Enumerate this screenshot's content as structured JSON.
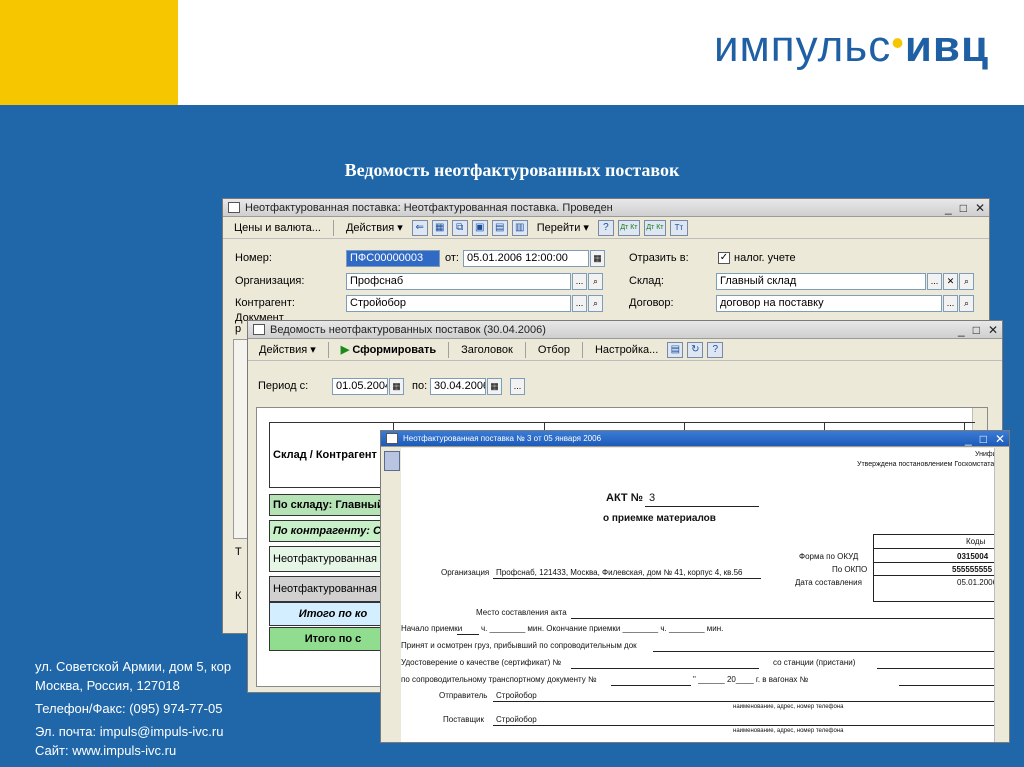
{
  "logo": {
    "left": "импульс",
    "dot": "•",
    "right": "ивц"
  },
  "slide_title": "Ведомость неотфактурованных поставок",
  "contacts": [
    "ул. Советской Армии, дом 5, кор",
    "Москва, Россия, 127018",
    "Телефон/Факс: (095) 974-77-05",
    "Эл. почта: impuls@impuls-ivc.ru",
    "Сайт: www.impuls-ivc.ru"
  ],
  "window1": {
    "title": "Неотфактурованная поставка: Неотфактурованная поставка. Проведен",
    "toolbar": {
      "prices": "Цены и валюта...",
      "actions": "Действия",
      "goto": "Перейти"
    },
    "labels": {
      "number": "Номер:",
      "org": "Организация:",
      "contractor": "Контрагент:",
      "doc": "Документ",
      "from": "от:",
      "reflect": "Отразить в:",
      "warehouse": "Склад:",
      "contract": "Договор:",
      "t_edge": "Т",
      "k_edge": "К",
      "r_edge": "р"
    },
    "values": {
      "number": "ПФС00000003",
      "date": "05.01.2006 12:00:00",
      "tax": "налог. учете",
      "org": "Профснаб",
      "warehouse": "Главный склад",
      "contractor": "Стройобор",
      "contract": "договор на поставку"
    },
    "tt_icons": [
      "Дт Кт",
      "Дт Кт",
      "Тт"
    ]
  },
  "window2": {
    "title": "Ведомость неотфактурованных поставок (30.04.2006)",
    "toolbar": {
      "actions": "Действия",
      "generate": "Сформировать",
      "header": "Заголовок",
      "filter": "Отбор",
      "settings": "Настройка..."
    },
    "period": {
      "label": "Период с:",
      "from": "01.05.2004",
      "to_label": "по:",
      "to": "30.04.2006"
    },
    "rows": [
      "Склад / Контрагент",
      "По складу: Главный",
      "По контрагенту: Ст",
      "Неотфактурованная по",
      "Неотфактурованная по",
      "Итого по ко",
      "Итого по с"
    ]
  },
  "window3": {
    "title": "Неотфактурованная поставка № 3 от 05 января 2006",
    "corner1": "Унифи",
    "corner2": "Утверждена постановлением Госкомстата",
    "akt_label": "АКТ №",
    "akt_num": "3",
    "subtitle": "о приемке материалов",
    "codes_header": "Коды",
    "okud_label": "Форма по ОКУД",
    "okud": "0315004",
    "okpo_label": "По ОКПО",
    "okpo": "555555555",
    "date_label": "Дата составления",
    "date": "05.01.2006",
    "org_label": "Организация",
    "org_value": "Профснаб, 121433, Москва, Филевская, дом № 41, корпус 4, кв.56",
    "place": "Место составления акта",
    "start_label": "Начало приемки",
    "start_rest": "ч. ________ мин. Окончание приемки ________ ч. ________ мин.",
    "accepted": "Принят и осмотрен груз, прибывший по сопроводительным док",
    "quality": "Удостоверение о качестве (сертификат) №",
    "station": "со станции (пристани)",
    "transport": "по сопроводительному транспортному документу №",
    "transport_rest": "\" ______ 20____ г. в вагонах №",
    "sender_label": "Отправитель",
    "sender": "Стройобор",
    "supplier_label": "Поставщик",
    "supplier": "Стройобор",
    "caption": "наименование, адрес, номер телефона"
  }
}
